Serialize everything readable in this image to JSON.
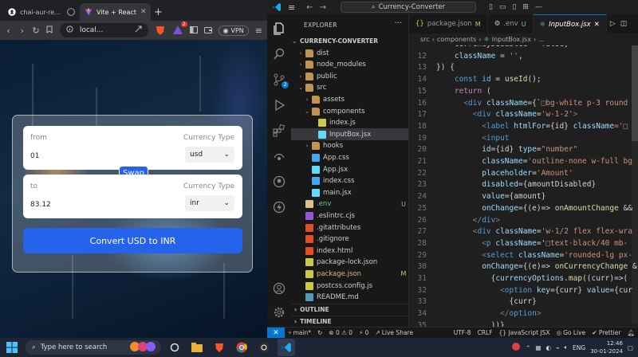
{
  "browser": {
    "tabs": [
      {
        "label": "chai-aur-react/..."
      },
      {
        "label": "Vite + React"
      }
    ],
    "new_tab": "+",
    "url": "local...",
    "brave_count": "2",
    "vpn": "VPN"
  },
  "converter": {
    "from": {
      "label": "from",
      "value": "01",
      "currency_type_label": "Currency Type",
      "currency": "usd"
    },
    "swap_label": "Swap",
    "to": {
      "label": "to",
      "value": "83.12",
      "currency_type_label": "Currency Type",
      "currency": "inr"
    },
    "convert_label": "Convert USD to INR",
    "accent": "#2563eb"
  },
  "vscode": {
    "search": "Currency-Converter",
    "explorer": {
      "header": "EXPLORER",
      "project": "CURRENCY-CONVERTER",
      "items": [
        {
          "name": "dist",
          "type": "folder",
          "depth": 1,
          "open": false,
          "badge": ""
        },
        {
          "name": "node_modules",
          "type": "folder",
          "depth": 1,
          "open": false,
          "badge": ""
        },
        {
          "name": "public",
          "type": "folder",
          "depth": 1,
          "open": false,
          "badge": ""
        },
        {
          "name": "src",
          "type": "folder",
          "depth": 1,
          "open": true,
          "badge": ""
        },
        {
          "name": "assets",
          "type": "folder",
          "depth": 2,
          "open": false,
          "badge": ""
        },
        {
          "name": "components",
          "type": "folder",
          "depth": 2,
          "open": true,
          "badge": ""
        },
        {
          "name": "index.js",
          "type": "js",
          "depth": 3,
          "open": false,
          "badge": ""
        },
        {
          "name": "InputBox.jsx",
          "type": "jsx",
          "depth": 3,
          "open": false,
          "badge": "",
          "selected": true
        },
        {
          "name": "hooks",
          "type": "folder",
          "depth": 2,
          "open": false,
          "badge": ""
        },
        {
          "name": "App.css",
          "type": "css",
          "depth": 2,
          "open": false,
          "badge": ""
        },
        {
          "name": "App.jsx",
          "type": "jsx",
          "depth": 2,
          "open": false,
          "badge": ""
        },
        {
          "name": "index.css",
          "type": "css",
          "depth": 2,
          "open": false,
          "badge": ""
        },
        {
          "name": "main.jsx",
          "type": "jsx",
          "depth": 2,
          "open": false,
          "badge": ""
        },
        {
          "name": ".env",
          "type": "env",
          "depth": 1,
          "open": false,
          "badge": "U"
        },
        {
          "name": ".eslintrc.cjs",
          "type": "eslint",
          "depth": 1,
          "open": false,
          "badge": ""
        },
        {
          "name": ".gitattributes",
          "type": "git",
          "depth": 1,
          "open": false,
          "badge": ""
        },
        {
          "name": ".gitignore",
          "type": "git",
          "depth": 1,
          "open": false,
          "badge": ""
        },
        {
          "name": "index.html",
          "type": "html",
          "depth": 1,
          "open": false,
          "badge": ""
        },
        {
          "name": "package-lock.json",
          "type": "json",
          "depth": 1,
          "open": false,
          "badge": ""
        },
        {
          "name": "package.json",
          "type": "json",
          "depth": 1,
          "open": false,
          "badge": "M"
        },
        {
          "name": "postcss.config.js",
          "type": "js",
          "depth": 1,
          "open": false,
          "badge": ""
        },
        {
          "name": "README.md",
          "type": "md",
          "depth": 1,
          "open": false,
          "badge": ""
        }
      ],
      "outline": "OUTLINE",
      "timeline": "TIMELINE"
    },
    "tabs": [
      {
        "label": "package.json",
        "badge": "M",
        "active": false
      },
      {
        "label": ".env",
        "badge": "U",
        "active": false
      },
      {
        "label": "InputBox.jsx",
        "badge": "",
        "active": true
      }
    ],
    "breadcrumb": [
      "src",
      "components",
      "InputBox.jsx",
      "..."
    ],
    "code_lines": [
      {
        "n": "",
        "t": [
          [
            "    currencyDisabled = false,",
            "#d4d4d4"
          ]
        ]
      },
      {
        "n": "12",
        "t": [
          [
            "    className = ",
            "#9cdcfe"
          ],
          [
            "''",
            "#ce9178"
          ],
          [
            ",",
            "#d4d4d4"
          ]
        ]
      },
      {
        "n": "13",
        "t": [
          [
            "}) {",
            "#d4d4d4"
          ]
        ]
      },
      {
        "n": "14",
        "t": [
          [
            "    ",
            "#d4d4d4"
          ],
          [
            "const ",
            "#569cd6"
          ],
          [
            "id",
            "#4fc1ff"
          ],
          [
            " = ",
            "#d4d4d4"
          ],
          [
            "useId",
            "#dcdcaa"
          ],
          [
            "();",
            "#d4d4d4"
          ]
        ]
      },
      {
        "n": "15",
        "t": [
          [
            "    ",
            "#d4d4d4"
          ],
          [
            "return ",
            "#c586c0"
          ],
          [
            "(",
            "#d4d4d4"
          ]
        ]
      },
      {
        "n": "16",
        "t": [
          [
            "      <",
            "#808080"
          ],
          [
            "div ",
            "#569cd6"
          ],
          [
            "className",
            "#9cdcfe"
          ],
          [
            "={`",
            "#d4d4d4"
          ],
          [
            "□bg-white p-3 round",
            "#ce9178"
          ]
        ]
      },
      {
        "n": "17",
        "t": [
          [
            "        <",
            "#808080"
          ],
          [
            "div ",
            "#569cd6"
          ],
          [
            "className",
            "#9cdcfe"
          ],
          [
            "=",
            "#d4d4d4"
          ],
          [
            "'w-1-2'",
            "#ce9178"
          ],
          [
            ">",
            "#808080"
          ]
        ]
      },
      {
        "n": "18",
        "t": [
          [
            "          <",
            "#808080"
          ],
          [
            "label ",
            "#569cd6"
          ],
          [
            "htmlFor",
            "#9cdcfe"
          ],
          [
            "={id} ",
            "#d4d4d4"
          ],
          [
            "className",
            "#9cdcfe"
          ],
          [
            "='□",
            "#ce9178"
          ]
        ]
      },
      {
        "n": "19",
        "t": [
          [
            "          <",
            "#808080"
          ],
          [
            "input",
            "#569cd6"
          ]
        ]
      },
      {
        "n": "20",
        "t": [
          [
            "          ",
            "#d4d4d4"
          ],
          [
            "id",
            "#9cdcfe"
          ],
          [
            "={id} ",
            "#d4d4d4"
          ],
          [
            "type",
            "#9cdcfe"
          ],
          [
            "=",
            "#d4d4d4"
          ],
          [
            "\"number\"",
            "#ce9178"
          ]
        ]
      },
      {
        "n": "21",
        "t": [
          [
            "          ",
            "#d4d4d4"
          ],
          [
            "className",
            "#9cdcfe"
          ],
          [
            "=",
            "#d4d4d4"
          ],
          [
            "'outline-none w-full bg",
            "#ce9178"
          ]
        ]
      },
      {
        "n": "22",
        "t": [
          [
            "          ",
            "#d4d4d4"
          ],
          [
            "placeholder",
            "#9cdcfe"
          ],
          [
            "=",
            "#d4d4d4"
          ],
          [
            "'Amount'",
            "#ce9178"
          ]
        ]
      },
      {
        "n": "23",
        "t": [
          [
            "          ",
            "#d4d4d4"
          ],
          [
            "disabled",
            "#9cdcfe"
          ],
          [
            "={amountDisabled}",
            "#d4d4d4"
          ]
        ]
      },
      {
        "n": "24",
        "t": [
          [
            "          ",
            "#d4d4d4"
          ],
          [
            "value",
            "#9cdcfe"
          ],
          [
            "={amount}",
            "#d4d4d4"
          ]
        ]
      },
      {
        "n": "25",
        "t": [
          [
            "          ",
            "#d4d4d4"
          ],
          [
            "onChange",
            "#9cdcfe"
          ],
          [
            "={(e)=> ",
            "#d4d4d4"
          ],
          [
            "onAmountChange",
            "#dcdcaa"
          ],
          [
            " &&",
            "#d4d4d4"
          ]
        ]
      },
      {
        "n": "26",
        "t": [
          [
            "        </",
            "#808080"
          ],
          [
            "div",
            "#569cd6"
          ],
          [
            ">",
            "#808080"
          ]
        ]
      },
      {
        "n": "27",
        "t": [
          [
            "        <",
            "#808080"
          ],
          [
            "div ",
            "#569cd6"
          ],
          [
            "className",
            "#9cdcfe"
          ],
          [
            "=",
            "#d4d4d4"
          ],
          [
            "'w-1/2 flex flex-wra",
            "#ce9178"
          ]
        ]
      },
      {
        "n": "28",
        "t": [
          [
            "          <",
            "#808080"
          ],
          [
            "p ",
            "#569cd6"
          ],
          [
            "className",
            "#9cdcfe"
          ],
          [
            "='",
            "#d4d4d4"
          ],
          [
            "□text-black/40 mb-",
            "#ce9178"
          ]
        ]
      },
      {
        "n": "29",
        "t": [
          [
            "          <",
            "#808080"
          ],
          [
            "select ",
            "#569cd6"
          ],
          [
            "className",
            "#9cdcfe"
          ],
          [
            "=",
            "#d4d4d4"
          ],
          [
            "'rounded-lg px-",
            "#ce9178"
          ]
        ]
      },
      {
        "n": "30",
        "t": [
          [
            "          ",
            "#d4d4d4"
          ],
          [
            "onChange",
            "#9cdcfe"
          ],
          [
            "={(e)=> ",
            "#d4d4d4"
          ],
          [
            "onCurrencyChange",
            "#dcdcaa"
          ],
          [
            " &",
            "#d4d4d4"
          ]
        ]
      },
      {
        "n": "31",
        "t": [
          [
            "            {",
            "#d4d4d4"
          ],
          [
            "currencyOptions",
            "#9cdcfe"
          ],
          [
            ".",
            "#d4d4d4"
          ],
          [
            "map",
            "#dcdcaa"
          ],
          [
            "((curr)=>(",
            "#d4d4d4"
          ]
        ]
      },
      {
        "n": "32",
        "t": [
          [
            "              <",
            "#808080"
          ],
          [
            "option ",
            "#569cd6"
          ],
          [
            "key",
            "#9cdcfe"
          ],
          [
            "={curr} ",
            "#d4d4d4"
          ],
          [
            "value",
            "#9cdcfe"
          ],
          [
            "={cur",
            "#d4d4d4"
          ]
        ]
      },
      {
        "n": "33",
        "t": [
          [
            "                {curr}",
            "#d4d4d4"
          ]
        ]
      },
      {
        "n": "34",
        "t": [
          [
            "              </",
            "#808080"
          ],
          [
            "option",
            "#569cd6"
          ],
          [
            ">",
            "#808080"
          ]
        ]
      },
      {
        "n": "35",
        "t": [
          [
            "            ))}",
            "#d4d4d4"
          ]
        ]
      }
    ],
    "status": {
      "remote": "✕",
      "branch": "main*",
      "sync": "↻",
      "problems": "⊗ 0 ⚠ 0",
      "ports": "⚡ 0",
      "live_share": "Live Share",
      "encoding": "UTF-8",
      "eol": "CRLF",
      "language": "{} JavaScript JSX",
      "golive": "Go Live",
      "prettier": "✔ Prettier"
    }
  },
  "taskbar": {
    "search_placeholder": "Type here to search",
    "language": "ENG",
    "time": "12:46",
    "date": "30-01-2024"
  }
}
